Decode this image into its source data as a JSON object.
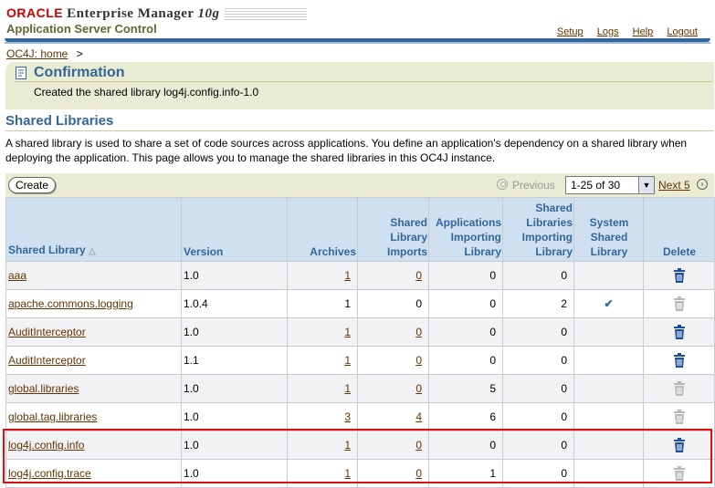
{
  "header": {
    "oracle": "ORACLE",
    "product": "Enterprise Manager",
    "version": "10g",
    "subtitle": "Application Server Control",
    "links": [
      "Setup",
      "Logs",
      "Help",
      "Logout"
    ]
  },
  "breadcrumb": {
    "home": "OC4J: home",
    "separator": ">"
  },
  "confirmation": {
    "title": "Confirmation",
    "message": "Created the shared library log4j.config.info-1.0"
  },
  "page": {
    "title": "Shared Libraries",
    "description": "A shared library is used to share a set of code sources across applications. You define an application's dependency on a shared library when deploying the application. This page allows you to manage the shared libraries in this OC4J instance."
  },
  "toolbar": {
    "create_label": "Create",
    "previous_label": "Previous",
    "range_value": "1-25 of 30",
    "next_label": "Next 5"
  },
  "table": {
    "columns": [
      "Shared Library",
      "Version",
      "Archives",
      "Shared Library Imports",
      "Applications Importing Library",
      "Shared Libraries Importing Library",
      "System Shared Library",
      "Delete"
    ],
    "rows": [
      {
        "name": "aaa",
        "version": "1.0",
        "archives": "1",
        "imports": "0",
        "apps": "0",
        "libs": "0",
        "system": "",
        "archives_link": true,
        "imports_link": true,
        "name_link": true,
        "delete_enabled": true
      },
      {
        "name": "apache.commons.logging",
        "version": "1.0.4",
        "archives": "1",
        "imports": "0",
        "apps": "0",
        "libs": "2",
        "system": "✔",
        "archives_link": false,
        "imports_link": false,
        "name_link": true,
        "delete_enabled": false
      },
      {
        "name": "AuditInterceptor",
        "version": "1.0",
        "archives": "1",
        "imports": "0",
        "apps": "0",
        "libs": "0",
        "system": "",
        "archives_link": true,
        "imports_link": true,
        "name_link": true,
        "delete_enabled": true
      },
      {
        "name": "AuditInterceptor",
        "version": "1.1",
        "archives": "1",
        "imports": "0",
        "apps": "0",
        "libs": "0",
        "system": "",
        "archives_link": true,
        "imports_link": true,
        "name_link": true,
        "delete_enabled": true
      },
      {
        "name": "global.libraries",
        "version": "1.0",
        "archives": "1",
        "imports": "0",
        "apps": "5",
        "libs": "0",
        "system": "",
        "archives_link": true,
        "imports_link": true,
        "name_link": true,
        "delete_enabled": false
      },
      {
        "name": "global.tag.libraries",
        "version": "1.0",
        "archives": "3",
        "imports": "4",
        "apps": "6",
        "libs": "0",
        "system": "",
        "archives_link": true,
        "imports_link": true,
        "name_link": true,
        "delete_enabled": false
      },
      {
        "name": "log4j.config.info",
        "version": "1.0",
        "archives": "1",
        "imports": "0",
        "apps": "0",
        "libs": "0",
        "system": "",
        "archives_link": true,
        "imports_link": true,
        "name_link": true,
        "delete_enabled": true
      },
      {
        "name": "log4j.config.trace",
        "version": "1.0",
        "archives": "1",
        "imports": "0",
        "apps": "1",
        "libs": "0",
        "system": "",
        "archives_link": true,
        "imports_link": true,
        "name_link": true,
        "delete_enabled": false
      }
    ]
  },
  "colors": {
    "accent": "#336699",
    "header_bg": "#cfe0f1",
    "link": "#663300",
    "panel_bg": "#e9ecd3",
    "highlight": "#e01010"
  }
}
